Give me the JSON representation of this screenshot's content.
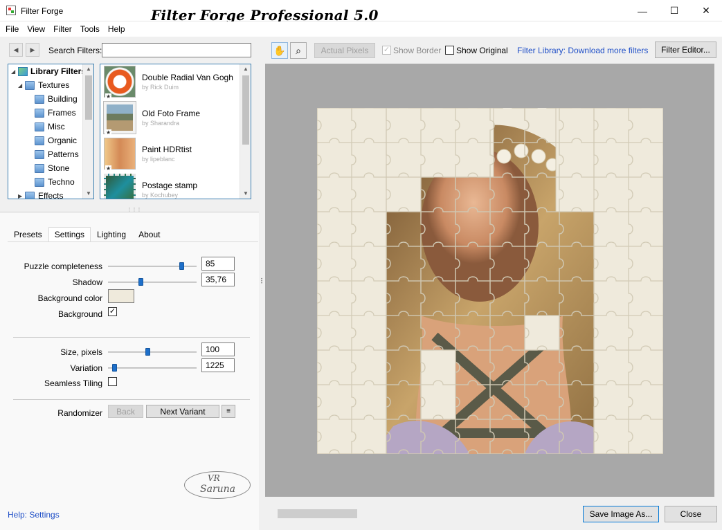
{
  "window": {
    "title": "Filter Forge",
    "brand": "Filter Forge Professional 5.0"
  },
  "menu": [
    "File",
    "View",
    "Filter",
    "Tools",
    "Help"
  ],
  "search": {
    "label": "Search Filters:",
    "value": ""
  },
  "tree": {
    "root": "Library Filters",
    "textures": "Textures",
    "children": [
      "Building",
      "Frames",
      "Misc",
      "Organic",
      "Patterns",
      "Stone",
      "Techno"
    ],
    "effects": "Effects"
  },
  "filters": [
    {
      "name": "Double Radial Van Gogh",
      "author": "by Rick Duim"
    },
    {
      "name": "Old Foto Frame",
      "author": "by Sharandra"
    },
    {
      "name": "Paint HDRtist",
      "author": "by lipeblanc"
    },
    {
      "name": "Postage stamp",
      "author": "by Kochubey"
    }
  ],
  "tabs": [
    "Presets",
    "Settings",
    "Lighting",
    "About"
  ],
  "active_tab": "Settings",
  "params": {
    "puzzle_completeness": {
      "label": "Puzzle completeness",
      "value": "85",
      "level": 0.85
    },
    "shadow": {
      "label": "Shadow",
      "value": "35,76",
      "level": 0.36
    },
    "background_color": {
      "label": "Background color",
      "color": "#efeadc"
    },
    "background": {
      "label": "Background",
      "checked": true
    },
    "size_pixels": {
      "label": "Size, pixels",
      "value": "100",
      "level": 0.45
    },
    "variation": {
      "label": "Variation",
      "value": "1225",
      "level": 0.05
    },
    "seamless_tiling": {
      "label": "Seamless Tiling",
      "checked": false
    }
  },
  "randomizer": {
    "label": "Randomizer",
    "back": "Back",
    "next": "Next Variant"
  },
  "signature": {
    "line1": "VR",
    "line2": "Saruna"
  },
  "help_link": "Help: Settings",
  "toolbar": {
    "actual_pixels": "Actual Pixels",
    "show_border": "Show Border",
    "show_original": "Show Original",
    "library_link": "Filter Library: Download more filters",
    "filter_editor": "Filter Editor..."
  },
  "bottom": {
    "save": "Save Image As...",
    "close": "Close"
  },
  "colors": {
    "accent": "#1e6fc9",
    "link": "#1f4fc7",
    "canvas_bg": "#a8a8a8"
  }
}
